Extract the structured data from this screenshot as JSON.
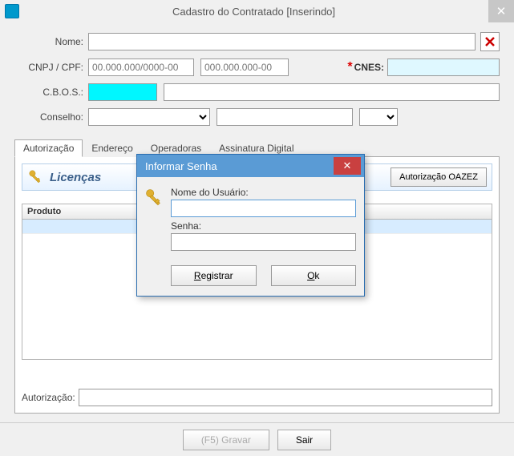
{
  "window": {
    "title": "Cadastro do Contratado [Inserindo]"
  },
  "form": {
    "nome_label": "Nome:",
    "nome_value": "",
    "cnpj_label": "CNPJ / CPF:",
    "cnpj_placeholder": "00.000.000/0000-00",
    "cpf_placeholder": "000.000.000-00",
    "cnpj_value": "",
    "cpf_value": "",
    "cnes_label": "CNES:",
    "cnes_value": "",
    "cbos_label": "C.B.O.S.:",
    "cbos_code": "",
    "cbos_desc": "",
    "conselho_label": "Conselho:",
    "conselho_value": "",
    "conselho_num": "",
    "conselho_uf": ""
  },
  "tabs": {
    "t0": "Autorização",
    "t1": "Endereço",
    "t2": "Operadoras",
    "t3": "Assinatura Digital"
  },
  "licenses": {
    "title": "Licenças",
    "oazez_btn": "Autorização OAZEZ",
    "grid_col_product": "Produto"
  },
  "auth": {
    "label": "Autorização:",
    "value": ""
  },
  "footer": {
    "save": "(F5)  Gravar",
    "exit": "Sair"
  },
  "modal": {
    "title": "Informar Senha",
    "user_label": "Nome do Usuário:",
    "user_value": "",
    "pass_label": "Senha:",
    "pass_value": "",
    "register_btn": "egistrar",
    "register_u": "R",
    "ok_btn": "k",
    "ok_u": "O"
  }
}
